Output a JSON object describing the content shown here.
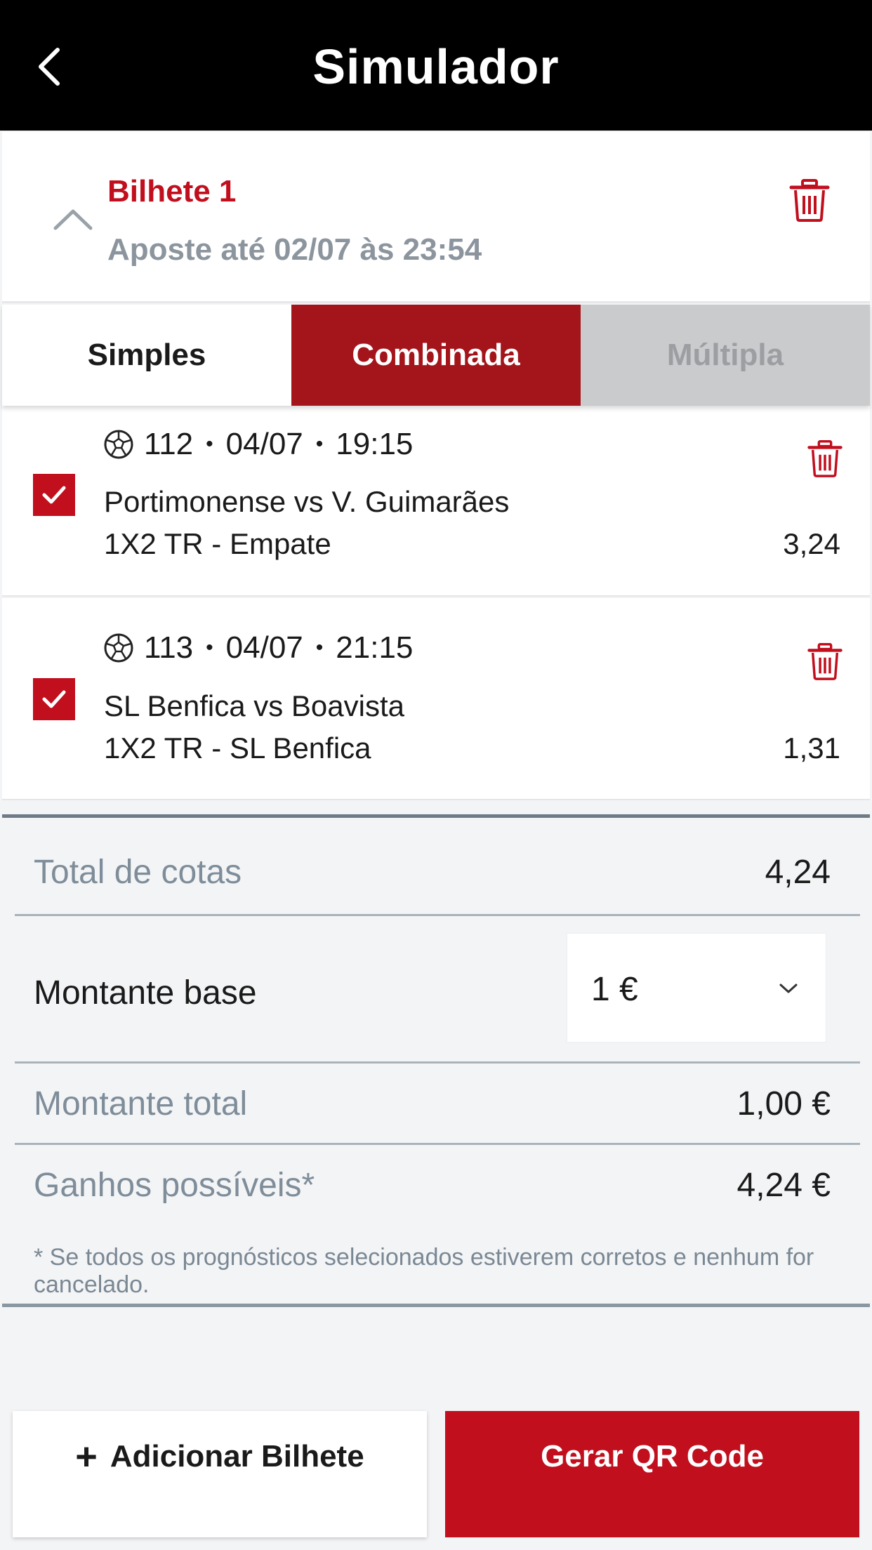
{
  "header": {
    "title": "Simulador"
  },
  "ticket": {
    "name": "Bilhete 1",
    "deadline": "Aposte até 02/07 às 23:54"
  },
  "tabs": [
    {
      "label": "Simples",
      "state": "default"
    },
    {
      "label": "Combinada",
      "state": "active"
    },
    {
      "label": "Múltipla",
      "state": "disabled"
    }
  ],
  "bets": [
    {
      "id": "112",
      "date": "04/07",
      "time": "19:15",
      "match": "Portimonense vs V. Guimarães",
      "market": "1X2 TR - Empate",
      "odd": "3,24",
      "checked": true
    },
    {
      "id": "113",
      "date": "04/07",
      "time": "21:15",
      "match": "SL Benfica vs Boavista",
      "market": "1X2 TR - SL Benfica",
      "odd": "1,31",
      "checked": true
    }
  ],
  "summary": {
    "total_cotas_label": "Total de cotas",
    "total_cotas_value": "4,24",
    "montante_base_label": "Montante base",
    "montante_base_value": "1 €",
    "montante_total_label": "Montante total",
    "montante_total_value": "1,00 €",
    "ganhos_label": "Ganhos possíveis*",
    "ganhos_value": "4,24 €",
    "footnote": "* Se todos os prognósticos selecionados estiverem corretos e nenhum for cancelado."
  },
  "buttons": {
    "add_ticket": "Adicionar Bilhete",
    "generate_qr": "Gerar QR Code"
  },
  "colors": {
    "brand_red": "#c10f1e",
    "tab_active": "#a3151b",
    "header_bg": "#000000"
  },
  "separator": "•"
}
